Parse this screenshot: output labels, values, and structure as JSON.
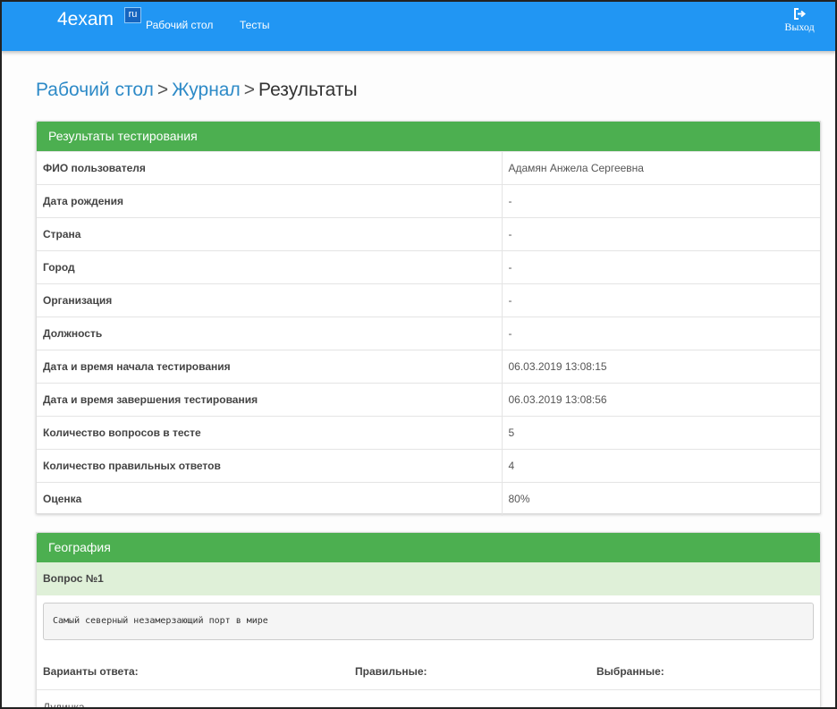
{
  "navbar": {
    "brand": "4exam",
    "brand_badge": "ru",
    "links": [
      "Рабочий стол",
      "Тесты"
    ],
    "logout_label": "Выход",
    "color": "#2196f3"
  },
  "breadcrumb": {
    "items": [
      "Рабочий стол",
      "Журнал"
    ],
    "separator": ">",
    "current": "Результаты"
  },
  "results_panel": {
    "title": "Результаты тестирования",
    "heading_color": "#4caf50",
    "rows": [
      {
        "label": "ФИО пользователя",
        "value": "Адамян Анжела Сергеевна"
      },
      {
        "label": "Дата рождения",
        "value": "-"
      },
      {
        "label": "Страна",
        "value": "-"
      },
      {
        "label": "Город",
        "value": "-"
      },
      {
        "label": "Организация",
        "value": "-"
      },
      {
        "label": "Должность",
        "value": "-"
      },
      {
        "label": "Дата и время начала тестирования",
        "value": "06.03.2019 13:08:15"
      },
      {
        "label": "Дата и время завершения тестирования",
        "value": "06.03.2019 13:08:56"
      },
      {
        "label": "Количество вопросов в тесте",
        "value": "5"
      },
      {
        "label": "Количество правильных ответов",
        "value": "4"
      },
      {
        "label": "Оценка",
        "value": "80%"
      }
    ]
  },
  "section_panel": {
    "title": "География",
    "question": {
      "header": "Вопрос №1",
      "text": "Самый северный незамерзающий порт в мире",
      "answers_header": {
        "options": "Варианты ответа:",
        "correct": "Правильные:",
        "chosen": "Выбранные:"
      },
      "options": [
        "Дудинка"
      ]
    }
  }
}
